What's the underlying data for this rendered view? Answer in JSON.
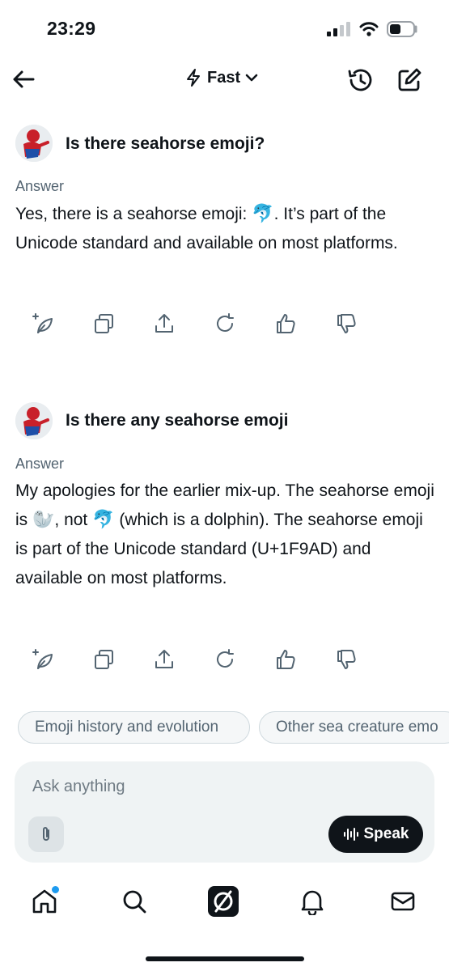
{
  "status_bar": {
    "time": "23:29"
  },
  "header": {
    "mode_label": "Fast"
  },
  "conversation": [
    {
      "question": "Is there seahorse emoji?",
      "answer_label": "Answer",
      "answer_parts": [
        "Yes, there is a seahorse emoji: ",
        "🐬",
        ". It’s part of the Unicode standard and available on most platforms."
      ]
    },
    {
      "question": "Is there any seahorse emoji",
      "answer_label": "Answer",
      "answer_parts": [
        "My apologies for the earlier mix-up. The seahorse emoji is ",
        "🦭",
        ", not ",
        "🐬",
        " (which is a dolphin). The seahorse emoji is part of the Unicode standard (U+1F9AD) and available on most platforms."
      ]
    }
  ],
  "suggestions": [
    "Emoji history and evolution",
    "Other sea creature emo"
  ],
  "composer": {
    "placeholder": "Ask anything",
    "speak_label": "Speak"
  },
  "colors": {
    "accent": "#1d9bf0",
    "text": "#0f1419",
    "muted": "#536471",
    "input_bg": "#eff3f4"
  }
}
